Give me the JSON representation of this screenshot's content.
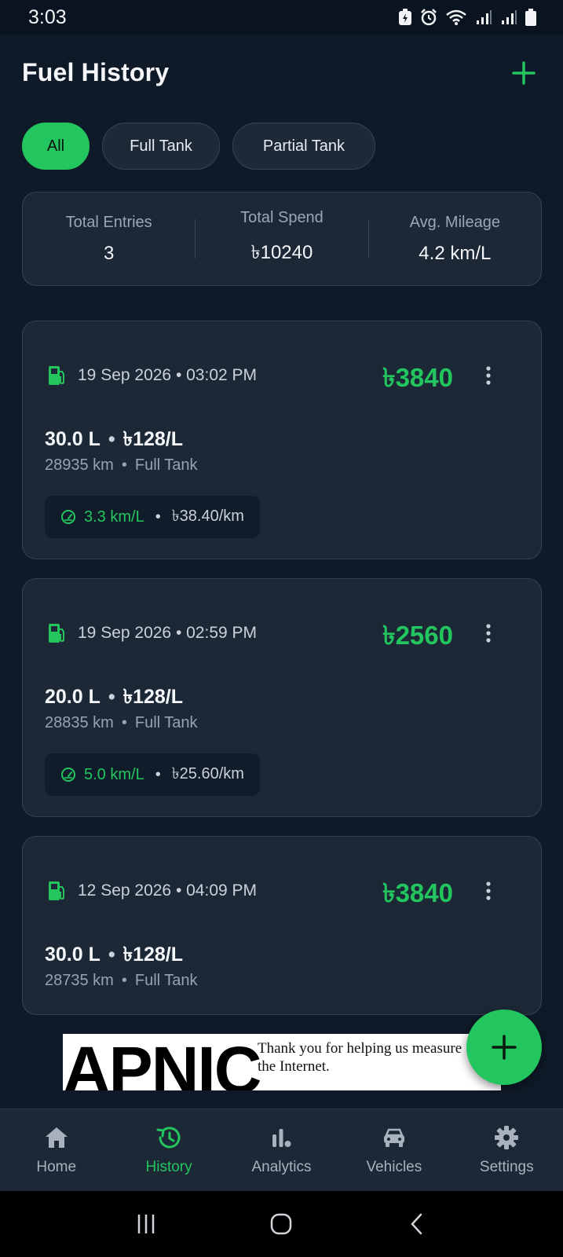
{
  "status_bar": {
    "time": "3:03"
  },
  "header": {
    "title": "Fuel History"
  },
  "filters": [
    {
      "label": "All",
      "active": true
    },
    {
      "label": "Full Tank",
      "active": false
    },
    {
      "label": "Partial Tank",
      "active": false
    }
  ],
  "summary": {
    "total_entries_label": "Total Entries",
    "total_entries_value": "3",
    "total_spend_label": "Total Spend",
    "total_spend_value": "৳10240",
    "avg_mileage_label": "Avg. Mileage",
    "avg_mileage_value": "4.2 km/L"
  },
  "entries": [
    {
      "date": "19 Sep 2026 • 03:02 PM",
      "amount": "৳3840",
      "volume": "30.0 L",
      "price": "৳128/L",
      "odometer": "28935 km",
      "fill_type": "Full Tank",
      "mileage": "3.3 km/L",
      "cost_per_km": "৳38.40/km"
    },
    {
      "date": "19 Sep 2026 • 02:59 PM",
      "amount": "৳2560",
      "volume": "20.0 L",
      "price": "৳128/L",
      "odometer": "28835 km",
      "fill_type": "Full Tank",
      "mileage": "5.0 km/L",
      "cost_per_km": "৳25.60/km"
    },
    {
      "date": "12 Sep 2026 • 04:09 PM",
      "amount": "৳3840",
      "volume": "30.0 L",
      "price": "৳128/L",
      "odometer": "28735 km",
      "fill_type": "Full Tank"
    }
  ],
  "ad": {
    "logo": "APNIC",
    "text": "Thank you for helping us measure the Internet."
  },
  "bottom_nav": [
    {
      "label": "Home",
      "icon": "home-icon",
      "active": false
    },
    {
      "label": "History",
      "icon": "history-icon",
      "active": true
    },
    {
      "label": "Analytics",
      "icon": "analytics-icon",
      "active": false
    },
    {
      "label": "Vehicles",
      "icon": "car-icon",
      "active": false
    },
    {
      "label": "Settings",
      "icon": "gear-icon",
      "active": false
    }
  ],
  "colors": {
    "accent": "#22c55e",
    "background": "#0f1a28",
    "card": "#1d2837"
  }
}
